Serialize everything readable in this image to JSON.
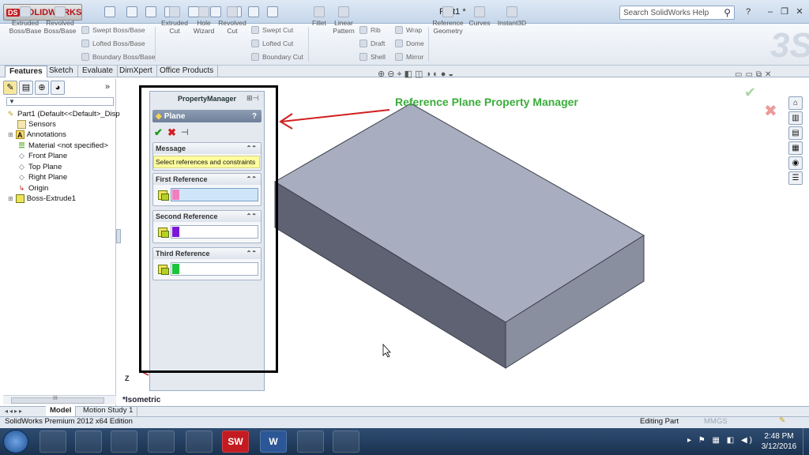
{
  "app": {
    "brand": "SOLIDWORKS",
    "brand_mark": "DS",
    "window_title": "Part1 *",
    "search_placeholder": "Search SolidWorks Help"
  },
  "ribbon": {
    "big_buttons": [
      {
        "label": "Extruded Boss/Base"
      },
      {
        "label": "Revolved Boss/Base"
      },
      {
        "label": "Extruded Cut"
      },
      {
        "label": "Hole Wizard"
      },
      {
        "label": "Revolved Cut"
      },
      {
        "label": "Fillet"
      },
      {
        "label": "Linear Pattern"
      },
      {
        "label": "Reference Geometry"
      },
      {
        "label": "Curves"
      },
      {
        "label": "Instant3D"
      }
    ],
    "small_buttons": {
      "swept_boss": "Swept Boss/Base",
      "lofted_boss": "Lofted Boss/Base",
      "boundary_boss": "Boundary Boss/Base",
      "swept_cut": "Swept Cut",
      "lofted_cut": "Lofted Cut",
      "boundary_cut": "Boundary Cut",
      "rib": "Rib",
      "draft": "Draft",
      "shell": "Shell",
      "wrap": "Wrap",
      "dome": "Dome",
      "mirror": "Mirror"
    }
  },
  "tabs": [
    "Features",
    "Sketch",
    "Evaluate",
    "DimXpert",
    "Office Products"
  ],
  "feature_tree": {
    "items": [
      {
        "label": "Part1  (Default<<Default>_Disp",
        "icon": "part-icon"
      },
      {
        "label": "Sensors",
        "icon": "sensor-icon"
      },
      {
        "label": "Annotations",
        "icon": "annotation-icon"
      },
      {
        "label": "Material <not specified>",
        "icon": "material-icon"
      },
      {
        "label": "Front Plane",
        "icon": "plane-icon"
      },
      {
        "label": "Top Plane",
        "icon": "plane-icon"
      },
      {
        "label": "Right Plane",
        "icon": "plane-icon"
      },
      {
        "label": "Origin",
        "icon": "origin-icon"
      },
      {
        "label": "Boss-Extrude1",
        "icon": "extrude-icon"
      }
    ],
    "scroll_label": "III"
  },
  "property_manager": {
    "header": "PropertyManager",
    "title": "Plane",
    "help": "?",
    "sections": {
      "message": {
        "title": "Message",
        "text": "Select references and constraints"
      },
      "first": {
        "title": "First Reference",
        "color": "#f27fbd"
      },
      "second": {
        "title": "Second Reference",
        "color": "#7c17d9"
      },
      "third": {
        "title": "Third Reference",
        "color": "#1cc43b"
      }
    }
  },
  "annotation": "Reference Plane Property Manager",
  "viewport": {
    "view_label": "*Isometric",
    "triad_label": "Z"
  },
  "bottom_tabs": [
    "Model",
    "Motion Study 1"
  ],
  "status": {
    "edition": "SolidWorks Premium 2012 x64 Edition",
    "mode": "Editing Part",
    "units": "MMGS"
  },
  "taskbar": {
    "apps": [
      "",
      "",
      "",
      "",
      "",
      "",
      "SW",
      "W",
      ""
    ],
    "time": "2:48 PM",
    "date": "3/12/2016"
  },
  "colors": {
    "accent": "#3aad3a",
    "arrow": "#d11f1f",
    "box_top": "#a8aebf",
    "box_front": "#8a8f9f",
    "box_side": "#5e6272"
  }
}
